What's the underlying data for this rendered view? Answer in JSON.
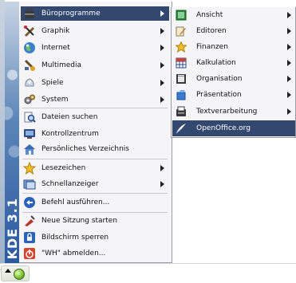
{
  "banner": {
    "text": "KDE 3.1"
  },
  "kmenu": {
    "items": [
      {
        "label": "Büroprogramme",
        "icon": "office-briefcase-icon",
        "submenu": true,
        "active": true
      },
      {
        "label": "Graphik",
        "icon": "graphics-pen-icon",
        "submenu": true
      },
      {
        "label": "Internet",
        "icon": "globe-icon",
        "submenu": true
      },
      {
        "label": "Multimedia",
        "icon": "multimedia-note-icon",
        "submenu": true
      },
      {
        "label": "Spiele",
        "icon": "games-icon",
        "submenu": true
      },
      {
        "label": "System",
        "icon": "system-gears-icon",
        "submenu": true
      },
      {
        "label": "Dateien suchen",
        "icon": "find-files-icon"
      },
      {
        "label": "Kontrollzentrum",
        "icon": "control-center-icon"
      },
      {
        "label": "Persönliches Verzeichnis",
        "icon": "home-folder-icon"
      },
      {
        "label": "Lesezeichen",
        "icon": "bookmark-star-icon",
        "submenu": true
      },
      {
        "label": "Schnellanzeiger",
        "icon": "quick-browser-icon",
        "submenu": true
      },
      {
        "label": "Befehl ausführen...",
        "icon": "run-command-icon"
      },
      {
        "label": "Neue Sitzung starten",
        "icon": "new-session-icon"
      },
      {
        "label": "Bildschirm sperren",
        "icon": "lock-screen-icon"
      },
      {
        "label": "\"WH\" abmelden...",
        "icon": "logout-icon"
      }
    ]
  },
  "submenu": {
    "items": [
      {
        "label": "Ansicht",
        "icon": "view-icon",
        "submenu": true
      },
      {
        "label": "Editoren",
        "icon": "editor-pen-icon",
        "submenu": true
      },
      {
        "label": "Finanzen",
        "icon": "finance-star-icon",
        "submenu": true
      },
      {
        "label": "Kalkulation",
        "icon": "spreadsheet-icon",
        "submenu": true
      },
      {
        "label": "Organisation",
        "icon": "organizer-icon",
        "submenu": true
      },
      {
        "label": "Präsentation",
        "icon": "presentation-icon",
        "submenu": true
      },
      {
        "label": "Textverarbeitung",
        "icon": "word-processor-icon",
        "submenu": true
      },
      {
        "label": "OpenOffice.org",
        "icon": "openoffice-icon",
        "active": true
      }
    ]
  },
  "colors": {
    "highlight": "#33486e",
    "menu_bg": "#f5f5f7"
  }
}
